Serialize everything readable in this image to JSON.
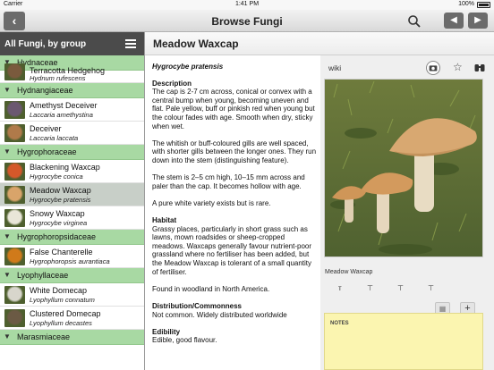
{
  "status": {
    "carrier": "Carrier",
    "time": "1:41 PM",
    "battery": "100%"
  },
  "navbar": {
    "title": "Browse Fungi",
    "back_icon": "chevron-left-icon",
    "prev_icon": "triangle-left-icon",
    "next_icon": "triangle-right-icon",
    "search_icon": "search-icon"
  },
  "sidebar": {
    "header": "All Fungi, by group",
    "groups": [
      {
        "name": "Hydnaceae",
        "items": [
          {
            "name": "Terracotta Hedgehog",
            "latin": "Hydnum rufescens",
            "partial": true,
            "color": "#7a5a3d"
          }
        ]
      },
      {
        "name": "Hydnangiaceae",
        "items": [
          {
            "name": "Amethyst Deceiver",
            "latin": "Laccaria amethystina",
            "color": "#6b5870"
          },
          {
            "name": "Deceiver",
            "latin": "Laccaria laccata",
            "color": "#b07a4a"
          }
        ]
      },
      {
        "name": "Hygrophoraceae",
        "items": [
          {
            "name": "Blackening Waxcap",
            "latin": "Hygrocybe conica",
            "color": "#d4582a"
          },
          {
            "name": "Meadow Waxcap",
            "latin": "Hygrocybe pratensis",
            "color": "#d9a46a",
            "selected": true
          },
          {
            "name": "Snowy Waxcap",
            "latin": "Hygrocybe virginea",
            "color": "#e9e6d8"
          }
        ]
      },
      {
        "name": "Hygrophoropsidaceae",
        "items": [
          {
            "name": "False Chanterelle",
            "latin": "Hygrophoropsis aurantiaca",
            "color": "#d07a1a"
          }
        ]
      },
      {
        "name": "Lyophyllaceae",
        "items": [
          {
            "name": "White Domecap",
            "latin": "Lyophyllum connatum",
            "color": "#d8d6cc"
          },
          {
            "name": "Clustered Domecap",
            "latin": "Lyophyllum decastes",
            "color": "#6b5a44"
          }
        ]
      },
      {
        "name": "Marasmiaceae",
        "items": []
      }
    ]
  },
  "detail": {
    "title": "Meadow Waxcap",
    "latin": "Hygrocybe pratensis",
    "description_heading": "Description",
    "description": [
      "The cap is 2-7 cm across, conical or convex with a central bump when young, becoming uneven and flat. Pale yellow, buff or pinkish red when young but the colour fades with age. Smooth when dry, sticky when wet.",
      "The whitish or buff-coloured gills are well spaced, with shorter gills between the longer ones. They run down into the stem (distinguishing feature).",
      "The stem is 2–5 cm high, 10–15 mm across and paler than the cap. It becomes hollow with age.",
      "A pure white variety exists but is rare."
    ],
    "habitat_heading": "Habitat",
    "habitat": [
      "Grassy places, particularly in short grass such as lawns, mown roadsides or sheep-cropped meadows. Waxcaps generally favour nutrient-poor grassland where no fertiliser has been added, but the Meadow Waxcap is tolerant of a small quantity of fertiliser.",
      "Found in woodland in North America."
    ],
    "distribution_heading": "Distribution/Commonness",
    "distribution": "Not common. Widely distributed worldwide",
    "edibility_heading": "Edibility",
    "edibility": "Edible, good flavour."
  },
  "panel": {
    "wiki_label": "wiki",
    "photo_caption": "Meadow Waxcap",
    "notes_label": "NOTES",
    "add_button": "+"
  }
}
